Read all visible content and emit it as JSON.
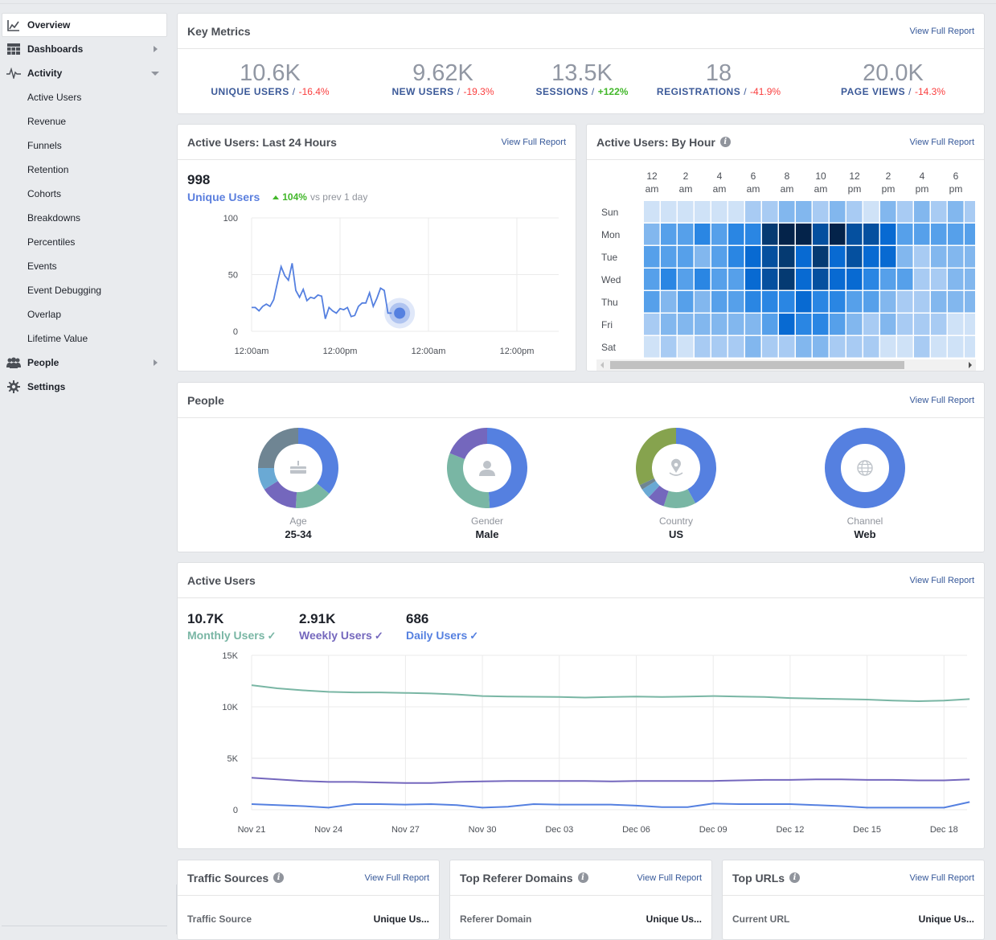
{
  "sidebar": {
    "items": [
      {
        "label": "Overview",
        "icon": "chart-icon",
        "active": true
      },
      {
        "label": "Dashboards",
        "icon": "grid-icon",
        "caret": "right"
      },
      {
        "label": "Activity",
        "icon": "pulse-icon",
        "caret": "down"
      },
      {
        "label": "People",
        "icon": "people-icon",
        "caret": "right"
      },
      {
        "label": "Settings",
        "icon": "gear-icon"
      }
    ],
    "activity_subitems": [
      "Active Users",
      "Revenue",
      "Funnels",
      "Retention",
      "Cohorts",
      "Breakdowns",
      "Percentiles",
      "Events",
      "Event Debugging",
      "Overlap",
      "Lifetime Value"
    ]
  },
  "common": {
    "view_full_report": "View Full Report"
  },
  "key_metrics": {
    "title": "Key Metrics",
    "metrics": [
      {
        "value": "10.6K",
        "label": "UNIQUE USERS",
        "change": "-16.4%",
        "trend": "neg"
      },
      {
        "value": "9.62K",
        "label": "NEW USERS",
        "change": "-19.3%",
        "trend": "neg"
      },
      {
        "value": "13.5K",
        "label": "SESSIONS",
        "change": "+122%",
        "trend": "pos"
      },
      {
        "value": "18",
        "label": "REGISTRATIONS",
        "change": "-41.9%",
        "trend": "neg"
      },
      {
        "value": "20.0K",
        "label": "PAGE VIEWS",
        "change": "-14.3%",
        "trend": "neg"
      }
    ]
  },
  "active_24h": {
    "title": "Active Users: Last 24 Hours",
    "value": "998",
    "label": "Unique Users",
    "change": "104%",
    "change_suffix": "vs prev 1 day",
    "color": "#5b7fde"
  },
  "by_hour": {
    "title": "Active Users: By Hour",
    "palette": [
      "#cfe2f7",
      "#a8cbf3",
      "#82b7ee",
      "#56a0ea",
      "#2a86e3",
      "#086ad2",
      "#05509f",
      "#053a72",
      "#04234a"
    ]
  },
  "people": {
    "title": "People",
    "donuts": [
      {
        "name": "Age",
        "value": "25-34",
        "icon": "cake-icon",
        "segments": [
          {
            "frac": 0.36,
            "color": "#5580e0"
          },
          {
            "frac": 0.15,
            "color": "#79b6a4"
          },
          {
            "frac": 0.15,
            "color": "#7467bd"
          },
          {
            "frac": 0.09,
            "color": "#6aa9d4"
          },
          {
            "frac": 0.25,
            "color": "#6f8593"
          }
        ]
      },
      {
        "name": "Gender",
        "value": "Male",
        "icon": "person-icon",
        "segments": [
          {
            "frac": 0.49,
            "color": "#5580e0"
          },
          {
            "frac": 0.32,
            "color": "#79b6a4"
          },
          {
            "frac": 0.19,
            "color": "#7467bd"
          }
        ]
      },
      {
        "name": "Country",
        "value": "US",
        "icon": "location-icon",
        "segments": [
          {
            "frac": 0.42,
            "color": "#5580e0"
          },
          {
            "frac": 0.13,
            "color": "#79b6a4"
          },
          {
            "frac": 0.07,
            "color": "#7467bd"
          },
          {
            "frac": 0.04,
            "color": "#6aa9d4"
          },
          {
            "frac": 0.02,
            "color": "#6f8593"
          },
          {
            "frac": 0.32,
            "color": "#86a34e"
          }
        ]
      },
      {
        "name": "Channel",
        "value": "Web",
        "icon": "globe-icon",
        "segments": [
          {
            "frac": 1.0,
            "color": "#5580e0"
          }
        ]
      }
    ]
  },
  "active_users": {
    "title": "Active Users",
    "summaries": [
      {
        "value": "10.7K",
        "label": "Monthly Users",
        "color": "#79b6a4"
      },
      {
        "value": "2.91K",
        "label": "Weekly Users",
        "color": "#7467bd"
      },
      {
        "value": "686",
        "label": "Daily Users",
        "color": "#5580e0"
      }
    ]
  },
  "traffic_sources": {
    "title": "Traffic Sources",
    "col1": "Traffic Source",
    "col2": "Unique Us..."
  },
  "referer_domains": {
    "title": "Top Referer Domains",
    "col1": "Referer Domain",
    "col2": "Unique Us..."
  },
  "top_urls": {
    "title": "Top URLs",
    "col1": "Current URL",
    "col2": "Unique Us..."
  },
  "chart_data": [
    {
      "type": "line",
      "title": "Active Users: Last 24 Hours",
      "ylim": [
        0,
        100
      ],
      "yticks": [
        "100",
        "50",
        "0"
      ],
      "yticks_values": [
        100,
        50,
        0
      ],
      "xticks": [
        "12:00am",
        "12:00pm",
        "12:00am",
        "12:00pm"
      ],
      "grid": true,
      "series": [
        {
          "name": "Unique Users",
          "color": "#5580e0",
          "values": [
            21,
            21,
            18,
            22,
            24,
            22,
            28,
            43,
            57,
            49,
            45,
            60,
            36,
            30,
            37,
            27,
            30,
            29,
            32,
            31,
            11,
            21,
            18,
            16,
            20,
            19,
            21,
            13,
            14,
            22,
            25,
            25,
            34,
            22,
            29,
            38,
            36,
            16,
            16
          ]
        }
      ],
      "x_points_per_half_day": 24,
      "highlight_last": true
    },
    {
      "type": "heatmap",
      "title": "Active Users: By Hour",
      "rows": [
        "Sun",
        "Mon",
        "Tue",
        "Wed",
        "Thu",
        "Fri",
        "Sat"
      ],
      "col_labels": [
        [
          "12",
          "am"
        ],
        [
          "2",
          "am"
        ],
        [
          "4",
          "am"
        ],
        [
          "6",
          "am"
        ],
        [
          "8",
          "am"
        ],
        [
          "10",
          "am"
        ],
        [
          "12",
          "pm"
        ],
        [
          "2",
          "pm"
        ],
        [
          "4",
          "pm"
        ],
        [
          "6",
          "pm"
        ]
      ],
      "levels": [
        [
          0,
          0,
          0,
          0,
          0,
          0,
          1,
          1,
          2,
          2,
          1,
          2,
          1,
          0,
          2,
          1,
          2,
          1,
          2,
          1
        ],
        [
          2,
          3,
          3,
          4,
          3,
          4,
          4,
          7,
          8,
          8,
          6,
          8,
          6,
          6,
          5,
          3,
          3,
          3,
          3,
          3
        ],
        [
          3,
          3,
          3,
          2,
          3,
          4,
          5,
          6,
          7,
          5,
          7,
          5,
          6,
          5,
          5,
          2,
          1,
          2,
          2,
          2
        ],
        [
          3,
          4,
          3,
          4,
          3,
          3,
          5,
          6,
          7,
          5,
          6,
          5,
          5,
          4,
          3,
          3,
          1,
          1,
          2,
          2
        ],
        [
          3,
          2,
          3,
          2,
          3,
          3,
          4,
          4,
          4,
          5,
          4,
          4,
          3,
          3,
          2,
          1,
          1,
          2,
          2,
          2
        ],
        [
          1,
          2,
          2,
          2,
          2,
          2,
          2,
          3,
          5,
          4,
          4,
          3,
          2,
          1,
          2,
          1,
          1,
          1,
          0,
          0
        ],
        [
          0,
          1,
          0,
          1,
          1,
          1,
          2,
          1,
          1,
          2,
          2,
          1,
          1,
          1,
          0,
          0,
          1,
          0,
          0,
          0
        ]
      ]
    },
    {
      "type": "line",
      "title": "Active Users",
      "ylim": [
        0,
        15000
      ],
      "yticks": [
        "15K",
        "10K",
        "5K",
        "0"
      ],
      "yticks_values": [
        15000,
        10000,
        5000,
        0
      ],
      "xticks": [
        "Nov 21",
        "Nov 24",
        "Nov 27",
        "Nov 30",
        "Dec 03",
        "Dec 06",
        "Dec 09",
        "Dec 12",
        "Dec 15",
        "Dec 18"
      ],
      "grid": true,
      "series": [
        {
          "name": "Monthly Users",
          "color": "#79b6a4",
          "values": [
            12100,
            11800,
            11600,
            11450,
            11400,
            11400,
            11350,
            11300,
            11200,
            11050,
            11000,
            10980,
            10950,
            10900,
            10950,
            11000,
            10950,
            11000,
            11050,
            11000,
            10950,
            10850,
            10800,
            10750,
            10700,
            10600,
            10550,
            10600,
            10750
          ]
        },
        {
          "name": "Weekly Users",
          "color": "#7467bd",
          "values": [
            3100,
            2950,
            2800,
            2700,
            2700,
            2650,
            2600,
            2600,
            2700,
            2750,
            2800,
            2800,
            2800,
            2800,
            2750,
            2800,
            2800,
            2800,
            2800,
            2850,
            2900,
            2900,
            2950,
            2950,
            2900,
            2900,
            2850,
            2850,
            2950
          ]
        },
        {
          "name": "Daily Users",
          "color": "#5580e0",
          "values": [
            550,
            450,
            350,
            200,
            550,
            550,
            500,
            550,
            450,
            200,
            300,
            550,
            500,
            500,
            500,
            400,
            250,
            250,
            600,
            550,
            550,
            550,
            450,
            350,
            200,
            200,
            200,
            200,
            750
          ]
        }
      ]
    }
  ]
}
